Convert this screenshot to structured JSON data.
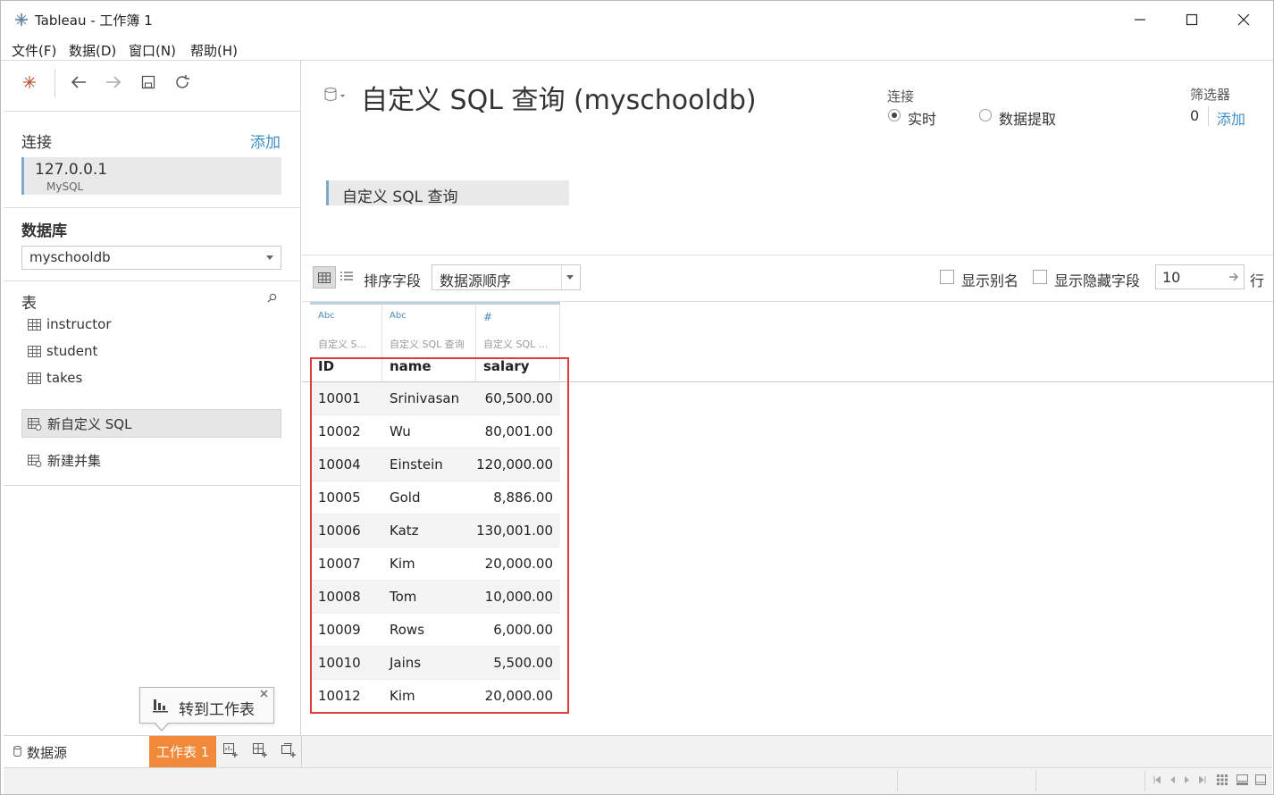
{
  "window": {
    "title": "Tableau - 工作簿 1",
    "menu": [
      "文件(F)",
      "数据(D)",
      "窗口(N)",
      "帮助(H)"
    ]
  },
  "left_pane": {
    "connections_title": "连接",
    "add_label": "添加",
    "connection": {
      "host": "127.0.0.1",
      "type": "MySQL"
    },
    "database_title": "数据库",
    "database_value": "myschooldb",
    "tables_title": "表",
    "tables": [
      "instructor",
      "student",
      "takes"
    ],
    "new_custom_sql": "新自定义 SQL",
    "new_union": "新建并集"
  },
  "main": {
    "title": "自定义 SQL 查询 (myschooldb)",
    "connection_label": "连接",
    "live_label": "实时",
    "extract_label": "数据提取",
    "connection_mode": "实时",
    "filters_label": "筛选器",
    "filters_count": "0",
    "filters_add": "添加",
    "canvas_tile": "自定义 SQL 查询"
  },
  "grid_toolbar": {
    "sort_label": "排序字段",
    "sort_value": "数据源顺序",
    "show_alias": "显示别名",
    "show_hidden": "显示隐藏字段",
    "rows_value": "10",
    "rows_unit": "行"
  },
  "grid": {
    "columns": [
      {
        "type": "Abc",
        "source": "自定义 S...",
        "name": "ID"
      },
      {
        "type": "Abc",
        "source": "自定义 SQL 查询",
        "name": "name"
      },
      {
        "type": "#",
        "source": "自定义 SQL ...",
        "name": "salary"
      }
    ],
    "rows": [
      [
        "10001",
        "Srinivasan",
        "60,500.00"
      ],
      [
        "10002",
        "Wu",
        "80,001.00"
      ],
      [
        "10004",
        "Einstein",
        "120,000.00"
      ],
      [
        "10005",
        "Gold",
        "8,886.00"
      ],
      [
        "10006",
        "Katz",
        "130,001.00"
      ],
      [
        "10007",
        "Kim",
        "20,000.00"
      ],
      [
        "10008",
        "Tom",
        "10,000.00"
      ],
      [
        "10009",
        "Rows",
        "6,000.00"
      ],
      [
        "10010",
        "Jains",
        "5,500.00"
      ],
      [
        "10012",
        "Kim",
        "20,000.00"
      ]
    ]
  },
  "bottom": {
    "datasource_tab": "数据源",
    "sheet_tab": "工作表 1",
    "tooltip": "转到工作表"
  },
  "colors": {
    "accent_blue": "#3d8fc6",
    "sheet_tab_orange": "#f08a3a",
    "highlight_red": "#e03c3c",
    "tile_border": "#7fa9c9"
  }
}
